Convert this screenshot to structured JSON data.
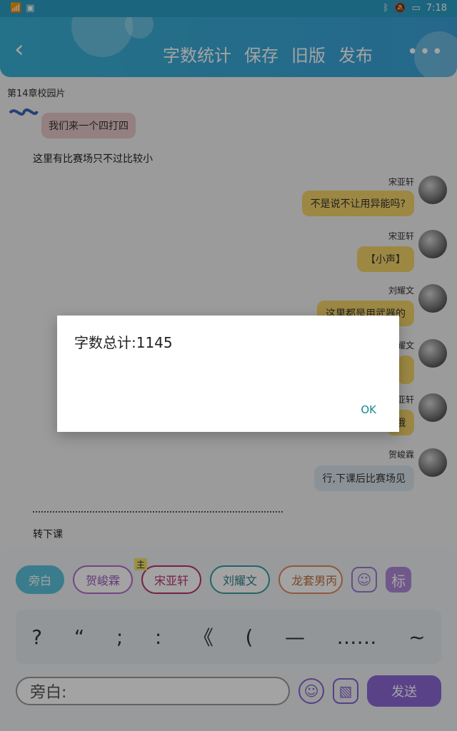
{
  "status": {
    "time": "7:18",
    "battery": "",
    "icons": [
      "wifi-icon",
      "bluetooth-icon",
      "mute-icon",
      "battery-icon"
    ]
  },
  "appbar": {
    "actions": [
      "字数统计",
      "保存",
      "旧版",
      "发布"
    ],
    "more": "•••"
  },
  "chapter": {
    "title": "第14章校园片"
  },
  "messages": [
    {
      "type": "left",
      "text": "我们来一个四打四"
    },
    {
      "type": "plain",
      "text": "这里有比赛场只不过比较小"
    },
    {
      "type": "right",
      "name": "宋亚轩",
      "text": "不是说不让用异能吗?"
    },
    {
      "type": "right",
      "name": "宋亚轩",
      "text": "【小声】"
    },
    {
      "type": "right",
      "name": "刘耀文",
      "text": "这里都是用武器的"
    },
    {
      "type": "right",
      "name": "刘耀文",
      "text": ""
    },
    {
      "type": "right",
      "name": "宋亚轩",
      "text": "哦"
    },
    {
      "type": "right",
      "name": "贺峻霖",
      "text": "行,下课后比赛场见"
    },
    {
      "type": "plain",
      "text": "转下课"
    }
  ],
  "composer": {
    "roles": [
      "旁白",
      "贺峻霖",
      "宋亚轩",
      "刘耀文",
      "龙套男丙"
    ],
    "main_role_tag": "主",
    "tag_button": "标",
    "symbols": [
      "?",
      "“",
      ";",
      ":",
      "《",
      "(",
      "—",
      "……",
      "~"
    ],
    "input_placeholder": "旁白:",
    "send": "发送"
  },
  "dialog": {
    "text": "字数总计:1145",
    "ok": "OK"
  }
}
